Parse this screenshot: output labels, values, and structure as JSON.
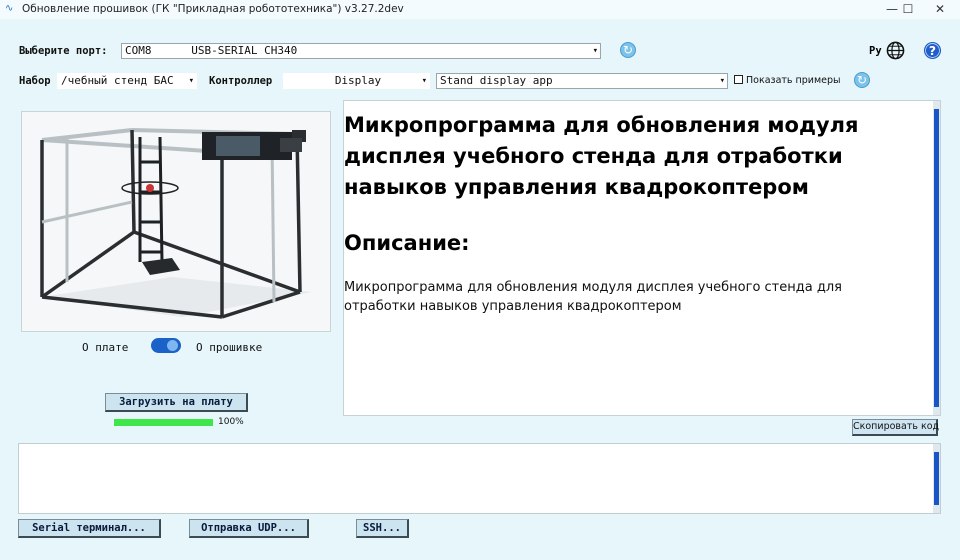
{
  "window": {
    "title": "Обновление прошивок (ГК \"Прикладная робототехника\") v3.27.2dev"
  },
  "port": {
    "label": "Выберите порт:",
    "value": "COM8      USB-SERIAL CH340"
  },
  "lang": {
    "label": "Ру"
  },
  "kit": {
    "label": "Набор",
    "value": "/чебный стенд БАС"
  },
  "controller": {
    "label": "Контроллер",
    "value": "Display"
  },
  "firmware": {
    "value": "Stand display app"
  },
  "show_examples": {
    "label": "Показать примеры"
  },
  "toggle": {
    "left": "О плате",
    "right": "О прошивке"
  },
  "content": {
    "title": "Микропрограмма для обновления модуля дисплея учебного стенда для отработки навыков управления квадрокоптером",
    "desc_heading": "Описание:",
    "desc_text": "Микропрограмма для обновления модуля дисплея учебного стенда для отработки навыков управления квадрокоптером"
  },
  "upload": {
    "label": "Загрузить на плату",
    "progress_text": "100%",
    "progress": 1.0
  },
  "copy_code": {
    "label": "Скопировать код"
  },
  "bottom": {
    "serial": "Serial терминал...",
    "udp": "Отправка UDP...",
    "ssh": "SSH..."
  },
  "colors": {
    "accent": "#1a55c6",
    "progress": "#3ee64a",
    "background": "#e6f6fb"
  }
}
